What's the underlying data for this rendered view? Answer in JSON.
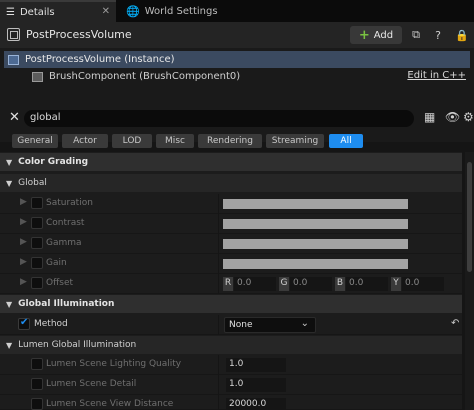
{
  "tabs": [
    {
      "label": "Details",
      "close": "✕"
    },
    {
      "label": "World Settings"
    }
  ],
  "header": {
    "title": "PostProcessVolume",
    "add_label": "Add"
  },
  "tree": {
    "instance": "PostProcessVolume (Instance)",
    "component": "BrushComponent (BrushComponent0)",
    "edit_link": "Edit in C++"
  },
  "search": {
    "value": "global"
  },
  "filters": [
    "General",
    "Actor",
    "LOD",
    "Misc",
    "Rendering",
    "Streaming",
    "All"
  ],
  "grid": {
    "color_grading": "Color Grading",
    "global": "Global",
    "props": {
      "saturation": "Saturation",
      "contrast": "Contrast",
      "gamma": "Gamma",
      "gain": "Gain",
      "offset": "Offset"
    },
    "offset_values": [
      {
        "axis": "R",
        "value": "0.0"
      },
      {
        "axis": "G",
        "value": "0.0"
      },
      {
        "axis": "B",
        "value": "0.0"
      },
      {
        "axis": "Y",
        "value": "0.0"
      }
    ],
    "global_illumination": "Global Illumination",
    "method": {
      "label": "Method",
      "value": "None"
    },
    "lumen_gi": "Lumen Global Illumination",
    "lumen_quality": {
      "label": "Lumen Scene Lighting Quality",
      "value": "1.0"
    },
    "lumen_detail": {
      "label": "Lumen Scene Detail",
      "value": "1.0"
    },
    "lumen_distance": {
      "label": "Lumen Scene View Distance",
      "value": "20000.0"
    }
  },
  "colors": {
    "accent": "#1e8df0",
    "selection": "#3b4a60",
    "add_plus": "#79c241"
  }
}
